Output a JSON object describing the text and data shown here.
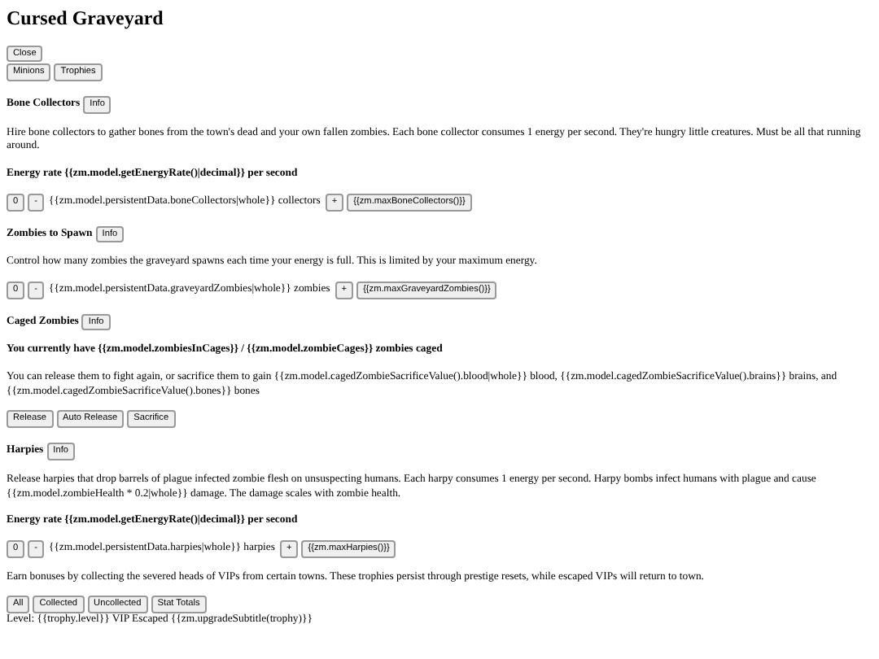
{
  "title": "Cursed Graveyard",
  "close_button": "Close",
  "tabs": [
    {
      "label": "Minions"
    },
    {
      "label": "Trophies"
    }
  ],
  "sections": [
    {
      "kind": "heading",
      "text": "Bone Collectors",
      "info": "Info"
    },
    {
      "kind": "paragraph",
      "text": "Hire bone collectors to gather bones from the town's dead and your own fallen zombies. Each bone collector consumes 1 energy per second. They're hungry little creatures. Must be all that running around."
    },
    {
      "kind": "bold",
      "text": "Energy rate {{zm.model.getEnergyRate()|decimal}} per second"
    },
    {
      "kind": "counter",
      "zero": "0",
      "minus": "-",
      "text": "{{zm.model.persistentData.boneCollectors|whole}} collectors",
      "plus": "+",
      "max": "{{zm.maxBoneCollectors()}}"
    },
    {
      "kind": "heading",
      "text": "Zombies to Spawn",
      "info": "Info"
    },
    {
      "kind": "paragraph",
      "text": "Control how many zombies the graveyard spawns each time your energy is full. This is limited by your maximum energy."
    },
    {
      "kind": "counter",
      "zero": "0",
      "minus": "-",
      "text": "{{zm.model.persistentData.graveyardZombies|whole}} zombies",
      "plus": "+",
      "max": "{{zm.maxGraveyardZombies()}}"
    },
    {
      "kind": "heading",
      "text": "Caged Zombies",
      "info": "Info"
    },
    {
      "kind": "bold",
      "text": "You currently have {{zm.model.zombiesInCages}} / {{zm.model.zombieCages}} zombies caged"
    },
    {
      "kind": "paragraph",
      "text": "You can release them to fight again, or sacrifice them to gain {{zm.model.cagedZombieSacrificeValue().blood|whole}} blood, {{zm.model.cagedZombieSacrificeValue().brains}} brains, and {{zm.model.cagedZombieSacrificeValue().bones}} bones"
    },
    {
      "kind": "buttons",
      "buttons": [
        "Release",
        "Auto Release",
        "Sacrifice"
      ]
    },
    {
      "kind": "heading",
      "text": "Harpies",
      "info": "Info"
    },
    {
      "kind": "paragraph",
      "text": "Release harpies that drop barrels of plague infected zombie flesh on unsuspecting humans. Each harpy consumes 1 energy per second. Harpy bombs infect humans with plague and cause {{zm.model.zombieHealth * 0.2|whole}} damage. The damage scales with zombie health."
    },
    {
      "kind": "bold",
      "text": "Energy rate {{zm.model.getEnergyRate()|decimal}} per second"
    },
    {
      "kind": "counter",
      "zero": "0",
      "minus": "-",
      "text": "{{zm.model.persistentData.harpies|whole}} harpies",
      "plus": "+",
      "max": "{{zm.maxHarpies()}}"
    },
    {
      "kind": "paragraph",
      "text": "Earn bonuses by collecting the severed heads of VIPs from certain towns. These trophies persist through prestige resets, while escaped VIPs will return to town."
    },
    {
      "kind": "buttons",
      "buttons": [
        "All",
        "Collected",
        "Uncollected",
        "Stat Totals"
      ]
    },
    {
      "kind": "line",
      "text": "Level: {{trophy.level}} VIP Escaped {{zm.upgradeSubtitle(trophy)}}"
    }
  ]
}
